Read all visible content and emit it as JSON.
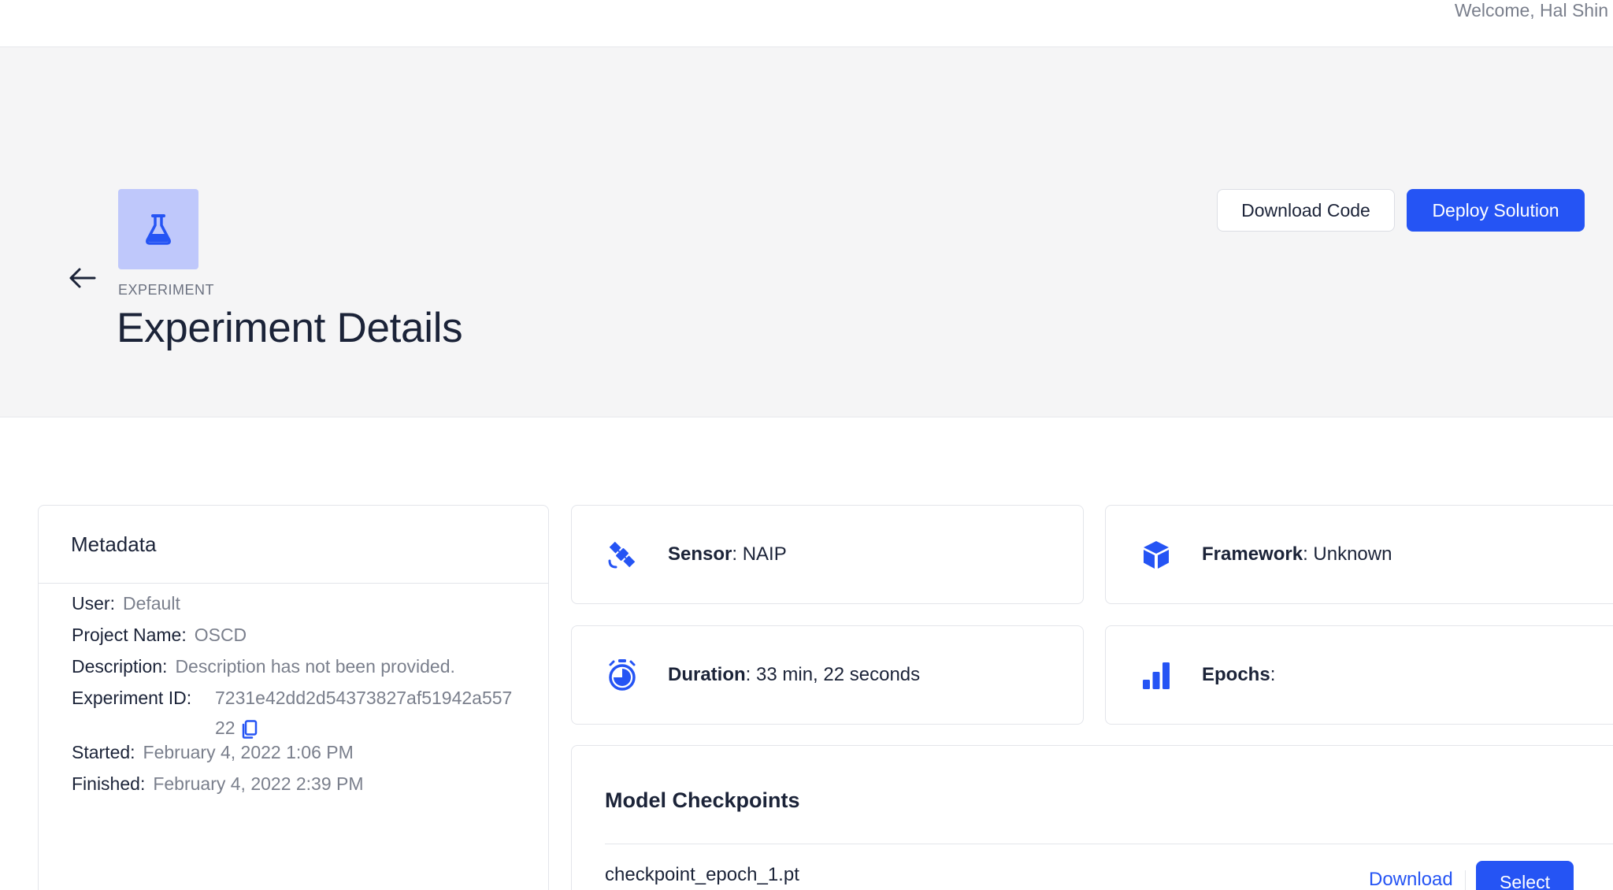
{
  "topbar": {
    "welcome": "Welcome, Hal Shin"
  },
  "header": {
    "eyebrow": "EXPERIMENT",
    "title": "Experiment Details",
    "buttons": {
      "download_code": "Download Code",
      "deploy": "Deploy Solution"
    }
  },
  "metadata": {
    "title": "Metadata",
    "rows": [
      {
        "key": "User",
        "value": "Default"
      },
      {
        "key": "Project Name",
        "value": "OSCD"
      },
      {
        "key": "Description",
        "value": "Description has not been provided."
      },
      {
        "key": "Experiment ID",
        "value": "7231e42dd2d54373827af51942a55722"
      },
      {
        "key": "Started",
        "value": "February 4, 2022 1:06 PM"
      },
      {
        "key": "Finished",
        "value": "February 4, 2022 2:39 PM"
      }
    ],
    "separator": ":"
  },
  "stats": {
    "sensor": {
      "label": "Sensor",
      "value": "NAIP",
      "icon": "satellite-icon"
    },
    "framework": {
      "label": "Framework",
      "value": "Unknown",
      "icon": "cube-icon"
    },
    "duration": {
      "label": "Duration",
      "value": "33 min, 22 seconds",
      "icon": "stopwatch-icon"
    },
    "epochs": {
      "label": "Epochs",
      "value": "",
      "icon": "bar-chart-icon"
    }
  },
  "checkpoints": {
    "title": "Model Checkpoints",
    "items": [
      {
        "name": "checkpoint_epoch_1.pt",
        "download_label": "Download",
        "select_label": "Select"
      }
    ]
  },
  "colors": {
    "accent": "#2554f4",
    "icon_tile": "#bfc8fb",
    "header_bg": "#f5f5f6"
  }
}
